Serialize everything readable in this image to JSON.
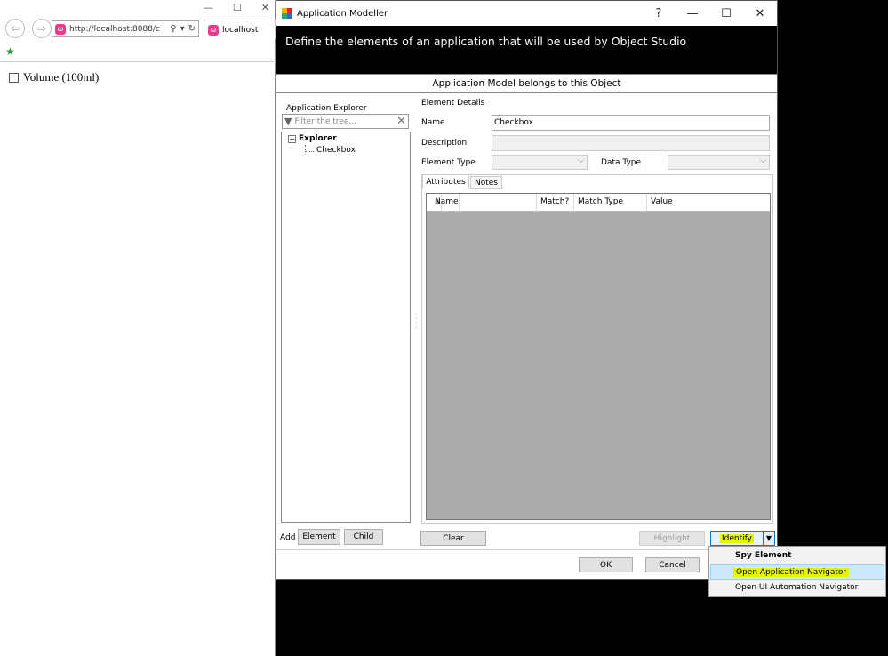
{
  "browser": {
    "url": "http://localhost:8088/c",
    "url_domain": "localhost",
    "tab_title": "localhost",
    "window_controls": [
      "—",
      "☐",
      "✕"
    ],
    "page_checkbox_label": "Volume (100ml)"
  },
  "modeller": {
    "title": "Application Modeller",
    "caption_buttons": [
      "?",
      "—",
      "☐",
      "✕"
    ],
    "banner": "Define the elements of an application that will be used by Object Studio",
    "belongs_to": "Application Model belongs to this Object",
    "explorer": {
      "label": "Application Explorer",
      "filter_placeholder": "Filter the tree...",
      "tree": {
        "root": "Explorer",
        "child": "Checkbox"
      },
      "add_label": "Add",
      "element_button": "Element",
      "child_button": "Child"
    },
    "details": {
      "label": "Element Details",
      "name_label": "Name",
      "name_value": "Checkbox",
      "description_label": "Description",
      "element_type_label": "Element Type",
      "data_type_label": "Data Type"
    },
    "tabs": {
      "attributes": "Attributes",
      "notes": "Notes"
    },
    "grid_columns": [
      "Name",
      "Match?",
      "Match Type",
      "Value"
    ],
    "buttons": {
      "clear": "Clear",
      "highlight": "Highlight",
      "identify": "Identify",
      "ok": "OK",
      "cancel": "Cancel"
    }
  },
  "identify_menu": {
    "items": [
      "Spy Element",
      "Open Application Navigator",
      "Open UI Automation Navigator"
    ]
  },
  "colors": {
    "highlight": "#e7f400",
    "selection": "#cce8ff",
    "banner": "#000000"
  }
}
